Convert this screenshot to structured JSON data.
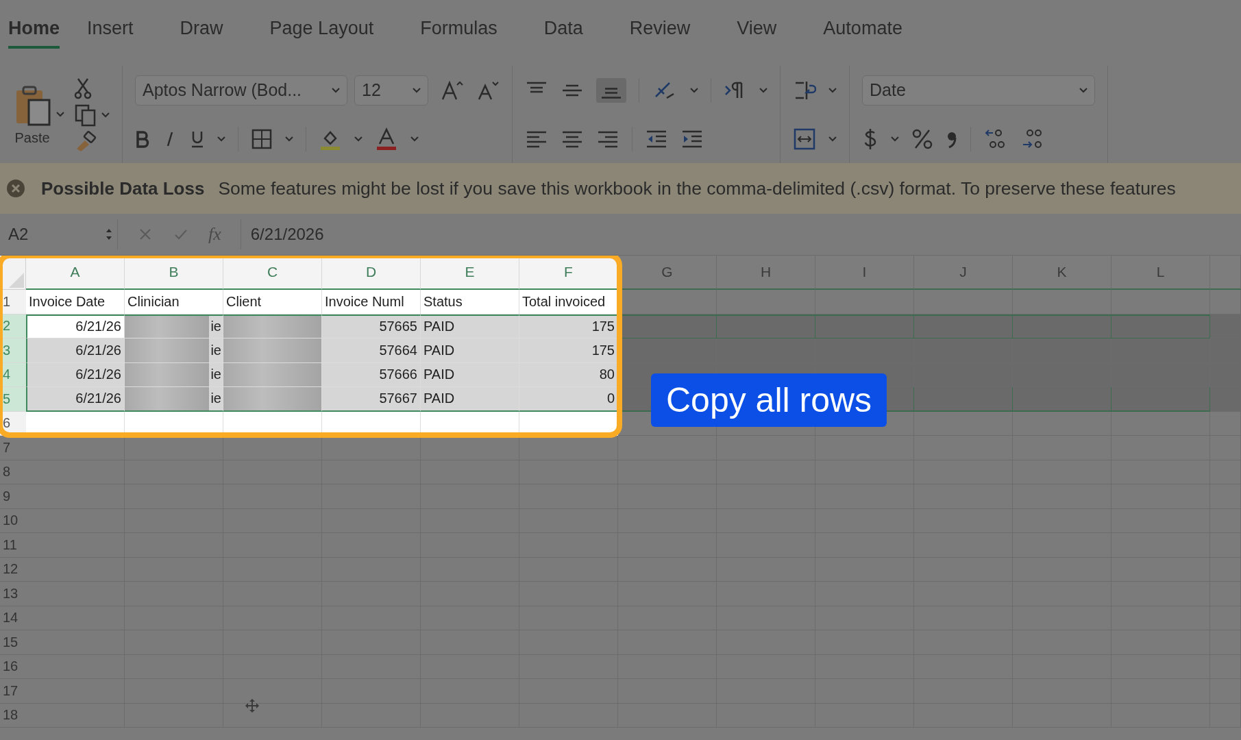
{
  "tabs": [
    {
      "label": "Home",
      "selected": true
    },
    {
      "label": "Insert",
      "selected": false
    },
    {
      "label": "Draw",
      "selected": false
    },
    {
      "label": "Page Layout",
      "selected": false
    },
    {
      "label": "Formulas",
      "selected": false
    },
    {
      "label": "Data",
      "selected": false
    },
    {
      "label": "Review",
      "selected": false
    },
    {
      "label": "View",
      "selected": false
    },
    {
      "label": "Automate",
      "selected": false
    }
  ],
  "ribbon": {
    "paste_label": "Paste",
    "font_name": "Aptos Narrow (Bod...",
    "font_size": "12",
    "number_format": "Date"
  },
  "banner": {
    "title": "Possible Data Loss",
    "message": "Some features might be lost if you save this workbook in the comma-delimited (.csv) format. To preserve these features"
  },
  "formula_bar": {
    "name_box": "A2",
    "function_label": "fx",
    "value": "6/21/2026"
  },
  "sheet": {
    "columns": [
      "A",
      "B",
      "C",
      "D",
      "E",
      "F",
      "G",
      "H",
      "I",
      "J",
      "K",
      "L"
    ],
    "rows": [
      {
        "header": "1",
        "selected": false,
        "cells": [
          {
            "kind": "text",
            "text": "Invoice Date"
          },
          {
            "kind": "text",
            "text": "Clinician"
          },
          {
            "kind": "text",
            "text": "Client"
          },
          {
            "kind": "text",
            "text": "Invoice Numl"
          },
          {
            "kind": "text",
            "text": "Status"
          },
          {
            "kind": "text",
            "text": "Total invoiced"
          }
        ]
      },
      {
        "header": "2",
        "selected": true,
        "cells": [
          {
            "kind": "number",
            "text": "6/21/26",
            "active": true
          },
          {
            "kind": "redacted",
            "text": "ie"
          },
          {
            "kind": "redacted"
          },
          {
            "kind": "number",
            "text": "57665"
          },
          {
            "kind": "text",
            "text": "PAID"
          },
          {
            "kind": "number",
            "text": "175"
          }
        ]
      },
      {
        "header": "3",
        "selected": true,
        "cells": [
          {
            "kind": "number",
            "text": "6/21/26",
            "active": false
          },
          {
            "kind": "redacted",
            "text": "ie"
          },
          {
            "kind": "redacted"
          },
          {
            "kind": "number",
            "text": "57664"
          },
          {
            "kind": "text",
            "text": "PAID"
          },
          {
            "kind": "number",
            "text": "175"
          }
        ]
      },
      {
        "header": "4",
        "selected": true,
        "cells": [
          {
            "kind": "number",
            "text": "6/21/26",
            "active": false
          },
          {
            "kind": "redacted",
            "text": "ie"
          },
          {
            "kind": "redacted"
          },
          {
            "kind": "number",
            "text": "57666"
          },
          {
            "kind": "text",
            "text": "PAID"
          },
          {
            "kind": "number",
            "text": "80"
          }
        ]
      },
      {
        "header": "5",
        "selected": true,
        "cells": [
          {
            "kind": "number",
            "text": "6/21/26",
            "active": false
          },
          {
            "kind": "redacted",
            "text": "ie"
          },
          {
            "kind": "redacted"
          },
          {
            "kind": "number",
            "text": "57667"
          },
          {
            "kind": "text",
            "text": "PAID"
          },
          {
            "kind": "number",
            "text": "0"
          }
        ]
      },
      {
        "header": "6",
        "selected": false,
        "cells": []
      },
      {
        "header": "7",
        "selected": false,
        "cells": []
      },
      {
        "header": "8",
        "selected": false,
        "cells": []
      },
      {
        "header": "9",
        "selected": false,
        "cells": []
      },
      {
        "header": "10",
        "selected": false,
        "cells": []
      },
      {
        "header": "11",
        "selected": false,
        "cells": []
      },
      {
        "header": "12",
        "selected": false,
        "cells": []
      },
      {
        "header": "13",
        "selected": false,
        "cells": []
      },
      {
        "header": "14",
        "selected": false,
        "cells": []
      },
      {
        "header": "15",
        "selected": false,
        "cells": []
      },
      {
        "header": "16",
        "selected": false,
        "cells": []
      },
      {
        "header": "17",
        "selected": false,
        "cells": []
      },
      {
        "header": "18",
        "selected": false,
        "cells": []
      }
    ]
  },
  "callout": {
    "text": "Copy all rows"
  }
}
